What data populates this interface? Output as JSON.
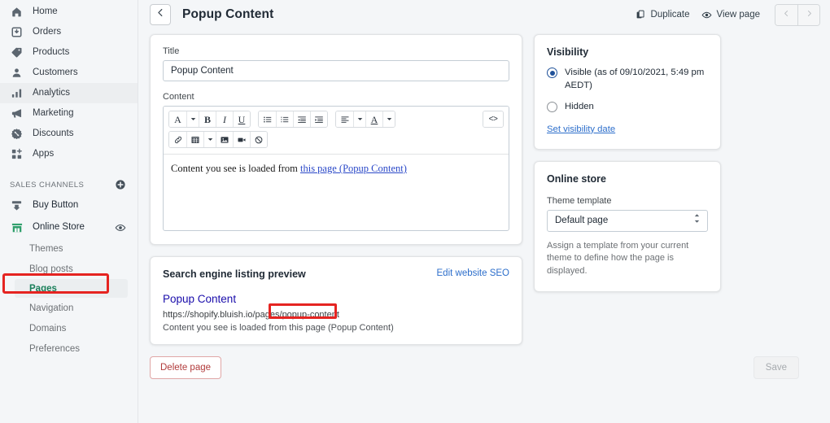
{
  "sidebar": {
    "nav": [
      {
        "label": "Home",
        "icon": "home-icon",
        "active": false
      },
      {
        "label": "Orders",
        "icon": "orders-icon",
        "active": false
      },
      {
        "label": "Products",
        "icon": "products-tag-icon",
        "active": false
      },
      {
        "label": "Customers",
        "icon": "customers-icon",
        "active": false
      },
      {
        "label": "Analytics",
        "icon": "analytics-bars-icon",
        "active": true
      },
      {
        "label": "Marketing",
        "icon": "marketing-megaphone-icon",
        "active": false
      },
      {
        "label": "Discounts",
        "icon": "discounts-percent-icon",
        "active": false
      },
      {
        "label": "Apps",
        "icon": "apps-grid-plus-icon",
        "active": false
      }
    ],
    "section_title": "SALES CHANNELS",
    "add_channel_icon": "plus-circle-icon",
    "channels": [
      {
        "label": "Buy Button",
        "icon": "buy-button-icon",
        "has_eye": false
      },
      {
        "label": "Online Store",
        "icon": "online-store-icon",
        "has_eye": true,
        "eye_icon": "eye-icon"
      }
    ],
    "sub_items": [
      {
        "label": "Themes",
        "current": false
      },
      {
        "label": "Blog posts",
        "current": false
      },
      {
        "label": "Pages",
        "current": true
      },
      {
        "label": "Navigation",
        "current": false
      },
      {
        "label": "Domains",
        "current": false
      },
      {
        "label": "Preferences",
        "current": false
      }
    ]
  },
  "header": {
    "back_icon": "arrow-left-icon",
    "title": "Popup Content",
    "duplicate_label": "Duplicate",
    "duplicate_icon": "duplicate-icon",
    "view_page_label": "View page",
    "view_page_icon": "eye-icon",
    "prev_icon": "chevron-left-icon",
    "next_icon": "chevron-right-icon"
  },
  "page_form": {
    "title_label": "Title",
    "title_value": "Popup Content",
    "content_label": "Content",
    "toolbar_row1": [
      {
        "name": "font-style-button",
        "glyph": "A",
        "serif": true,
        "caret": true
      },
      {
        "name": "bold-button",
        "glyph": "B",
        "serif": true,
        "bold": true,
        "caret": false
      },
      {
        "name": "italic-button",
        "glyph": "I",
        "serif": true,
        "italic": true,
        "caret": false
      },
      {
        "name": "underline-button",
        "glyph": "U",
        "serif": true,
        "underline": true,
        "caret": false
      }
    ],
    "toolbar_lists": [
      {
        "name": "bulleted-list-button",
        "icon": "bulleted-list-icon"
      },
      {
        "name": "numbered-list-button",
        "icon": "numbered-list-icon"
      },
      {
        "name": "outdent-button",
        "icon": "outdent-icon"
      },
      {
        "name": "indent-button",
        "icon": "indent-icon"
      }
    ],
    "toolbar_align": [
      {
        "name": "align-button",
        "icon": "align-left-icon",
        "caret": true
      },
      {
        "name": "text-color-button",
        "glyph": "A",
        "serif": true,
        "underline": true,
        "caret": true
      }
    ],
    "code_button": {
      "name": "html-code-button",
      "label": "<>"
    },
    "toolbar_row2": [
      {
        "name": "insert-link-button",
        "icon": "link-icon",
        "caret": false
      },
      {
        "name": "insert-table-button",
        "icon": "table-icon",
        "caret": true
      },
      {
        "name": "insert-image-button",
        "icon": "image-icon",
        "caret": false
      },
      {
        "name": "insert-video-button",
        "icon": "video-icon",
        "caret": false
      },
      {
        "name": "clear-formatting-button",
        "icon": "clear-formatting-icon",
        "caret": false
      }
    ],
    "body_prefix": "Content you see is loaded from ",
    "body_link": "this page (Popup Content)"
  },
  "seo": {
    "card_title": "Search engine listing preview",
    "edit_link": "Edit website SEO",
    "result_title": "Popup Content",
    "url_base": "https://shopify.bluish.io/pages/",
    "url_handle": "popup-content",
    "description": "Content you see is loaded from this page (Popup Content)"
  },
  "visibility": {
    "card_title": "Visibility",
    "visible_label": "Visible (as of 09/10/2021, 5:49 pm AEDT)",
    "hidden_label": "Hidden",
    "set_date_link": "Set visibility date",
    "selected": "visible",
    "accent_color": "#1f5199"
  },
  "online_store": {
    "card_title": "Online store",
    "template_label": "Theme template",
    "template_value": "Default page",
    "template_options": [
      "Default page"
    ],
    "select_icon": "updown-arrows-icon",
    "help_text": "Assign a template from your current theme to define how the page is displayed."
  },
  "footer": {
    "delete_label": "Delete page",
    "save_label": "Save"
  },
  "annotations": {
    "ring_color": "#e52421",
    "targets": [
      "sidebar-item-pages",
      "seo-url-handle"
    ]
  }
}
